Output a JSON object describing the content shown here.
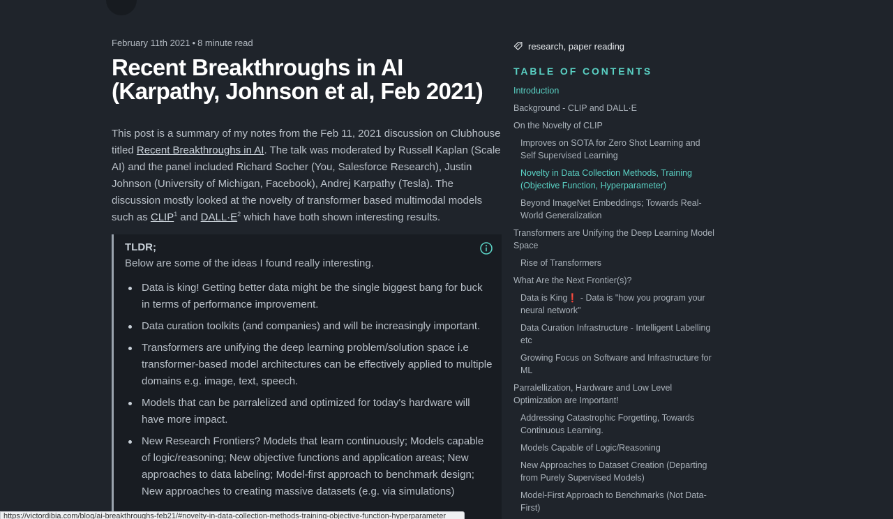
{
  "article": {
    "date": "February 11th 2021",
    "read_time": "8 minute read",
    "title": "Recent Breakthroughs in AI (Karpathy, Johnson et al, Feb 2021)",
    "intro": {
      "part1": "This post is a summary of my notes from the Feb 11, 2021 discussion on Clubhouse titled ",
      "link_talk": "Recent Breakthroughs in AI",
      "part2": ". The talk was moderated by Russell Kaplan (Scale AI) and the panel included Richard Socher (You, Salesforce Research), Justin Johnson (University of Michigan, Facebook), Andrej Karpathy (Tesla). The discussion mostly looked at the novelty of transformer based multimodal models such as ",
      "link_clip": "CLIP",
      "sup1": "1",
      "part3": " and ",
      "link_dalle": "DALL·E",
      "sup2": "2",
      "part4": " which have both shown interesting results."
    },
    "tldr": {
      "title": "TLDR;",
      "subtitle": "Below are some of the ideas I found really interesting.",
      "items": [
        "Data is king! Getting better data might be the single biggest bang for buck in terms of performance improvement.",
        "Data curation toolkits (and companies) and will be increasingly important.",
        "Transformers are unifying the deep learning problem/solution space i.e transformer-based model architectures can be effectively applied to multiple domains e.g. image, text, speech.",
        "Models that can be parralelized and optimized for today's hardware will have more impact.",
        "New Research Frontiers? Models that learn continuously; Models capable of logic/reasoning; New objective functions and application areas; New approaches to data labeling; Model-first approach to benchmark design; New approaches to creating massive datasets (e.g. via simulations)"
      ]
    }
  },
  "sidebar": {
    "tags": "research, paper reading",
    "toc_heading": "TABLE OF CONTENTS",
    "toc": [
      {
        "label": "Introduction",
        "level": 1,
        "active": true
      },
      {
        "label": "Background - CLIP and DALL·E",
        "level": 1
      },
      {
        "label": "On the Novelty of CLIP",
        "level": 1
      },
      {
        "label": "Improves on SOTA for Zero Shot Learning and Self Supervised Learning",
        "level": 2
      },
      {
        "label": "Novelty in Data Collection Methods, Training (Objective Function, Hyperparameter)",
        "level": 2,
        "active": true
      },
      {
        "label": "Beyond ImageNet Embeddings; Towards Real-World Generalization",
        "level": 2
      },
      {
        "label": "Transformers are Unifying the Deep Learning Model Space",
        "level": 1
      },
      {
        "label": "Rise of Transformers",
        "level": 2
      },
      {
        "label": "What Are the Next Frontier(s)?",
        "level": 1
      },
      {
        "label": "Data is King",
        "bang": "❗",
        "after": " - Data is \"how you program your neural network\"",
        "level": 2
      },
      {
        "label": "Data Curation Infrastructure - Intelligent Labelling etc",
        "level": 2
      },
      {
        "label": "Growing Focus on Software and Infrastructure for ML",
        "level": 2
      },
      {
        "label": "Parralellization, Hardware and Low Level Optimization are Important!",
        "level": 1
      },
      {
        "label": "Addressing Catastrophic Forgetting, Towards Continuous Learning.",
        "level": 2
      },
      {
        "label": "Models Capable of Logic/Reasoning",
        "level": 2
      },
      {
        "label": "New Approaches to Dataset Creation (Departing from Purely Supervised Models)",
        "level": 2
      },
      {
        "label": "Model-First Approach to Benchmarks (Not Data-First)",
        "level": 2
      }
    ]
  },
  "statusbar": {
    "url": "https://victordibia.com/blog/ai-breakthroughs-feb21/#novelty-in-data-collection-methods-training-objective-function-hyperparameter"
  },
  "colors": {
    "background": "#1f242b",
    "accent": "#5ad1c4",
    "callout_bg": "#181c22"
  }
}
